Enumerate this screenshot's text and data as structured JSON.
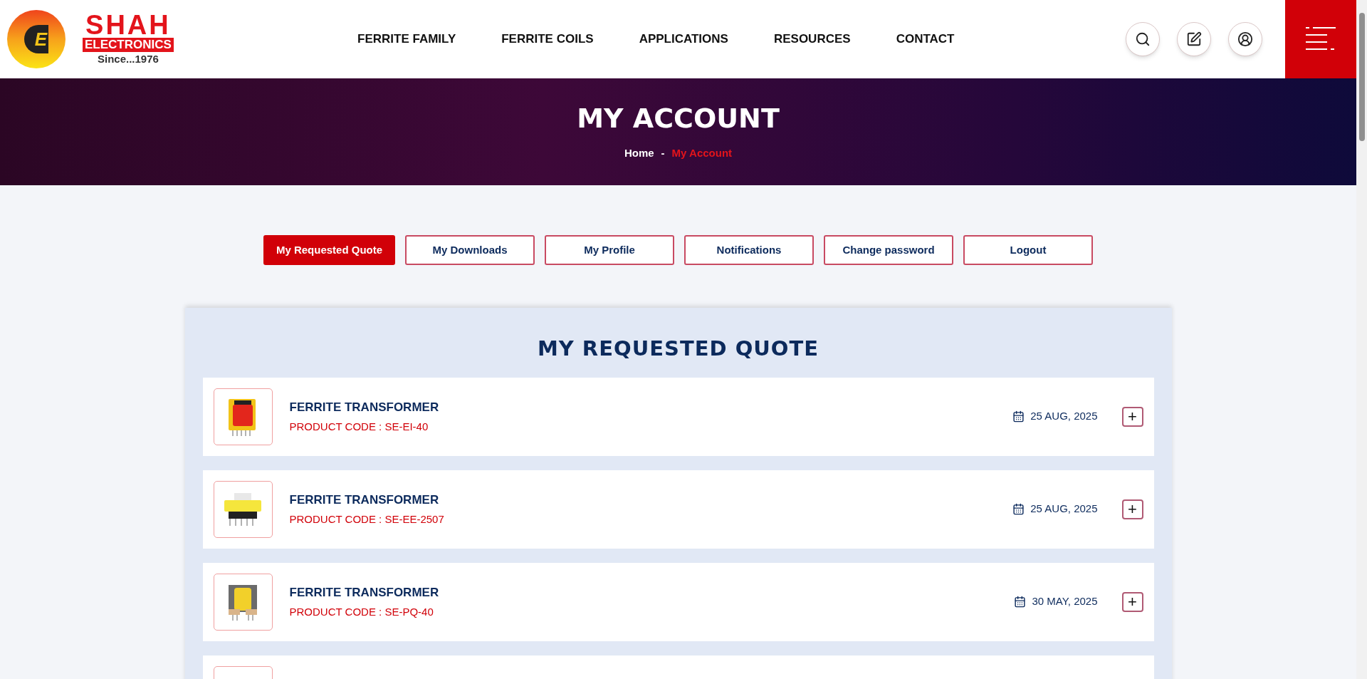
{
  "logo": {
    "mark": "E",
    "name": "SHAH",
    "subname": "ELECTRONICS",
    "tagline": "Since...1976"
  },
  "nav": [
    "FERRITE FAMILY",
    "FERRITE COILS",
    "APPLICATIONS",
    "RESOURCES",
    "CONTACT"
  ],
  "banner": {
    "title": "MY ACCOUNT",
    "breadcrumb": [
      {
        "label": "Home",
        "selected": false
      },
      {
        "label": "My Account",
        "selected": true
      }
    ],
    "separator": "-"
  },
  "tabs": [
    {
      "label": "My Requested Quote",
      "selected": true
    },
    {
      "label": "My Downloads",
      "selected": false
    },
    {
      "label": "My Profile",
      "selected": false
    },
    {
      "label": "Notifications",
      "selected": false
    },
    {
      "label": "Change password",
      "selected": false
    },
    {
      "label": "Logout",
      "selected": false
    }
  ],
  "section_title": "MY REQUESTED QUOTE",
  "quotes": [
    {
      "kind": "full",
      "thumbnail": {
        "kind": "ei"
      },
      "title": "FERRITE TRANSFORMER",
      "code": "PRODUCT CODE : SE-EI-40",
      "date": "25 AUG, 2025",
      "toggle": "+"
    },
    {
      "kind": "full",
      "thumbnail": {
        "kind": "ee"
      },
      "title": "FERRITE TRANSFORMER",
      "code": "PRODUCT CODE : SE-EE-2507",
      "date": "25 AUG, 2025",
      "toggle": "+"
    },
    {
      "kind": "full",
      "thumbnail": {
        "kind": "pq"
      },
      "title": "FERRITE TRANSFORMER",
      "code": "PRODUCT CODE : SE-PQ-40",
      "date": "30 MAY, 2025",
      "toggle": "+"
    },
    {
      "kind": "partial"
    }
  ]
}
